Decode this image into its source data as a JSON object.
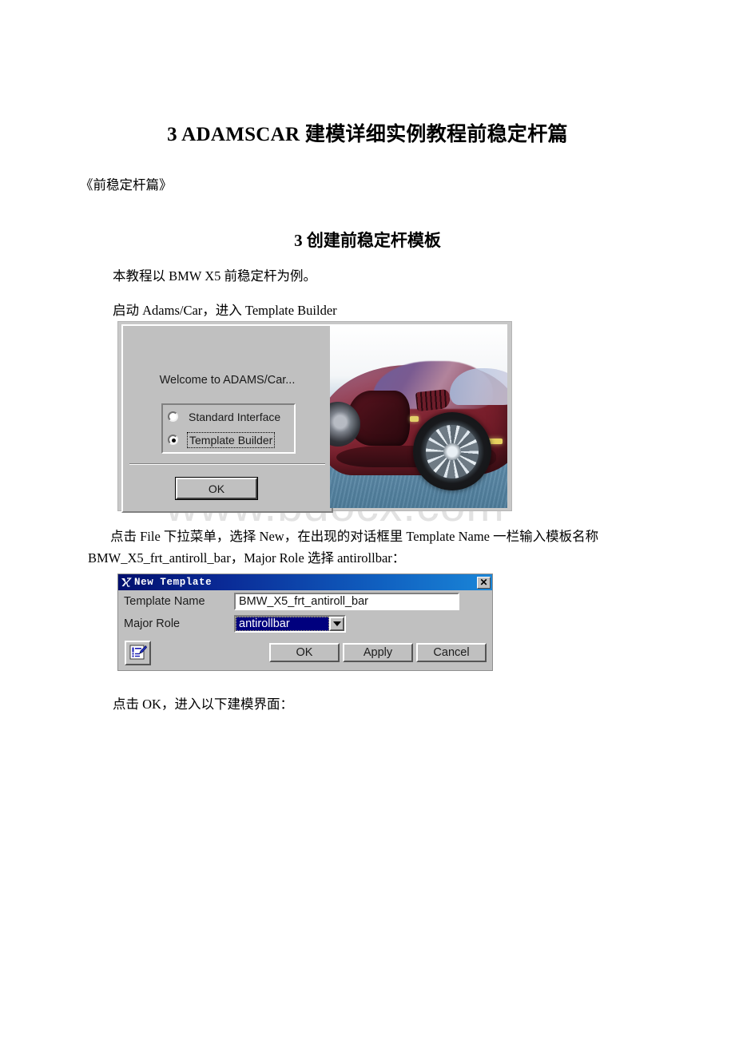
{
  "document": {
    "title": "3 ADAMSCAR 建模详细实例教程前稳定杆篇",
    "subtitle": "《前稳定杆篇》",
    "section_heading": "3 创建前稳定杆模板",
    "line_example": "本教程以 BMW X5 前稳定杆为例。",
    "line_launch": "启动 Adams/Car，进入 Template Builder",
    "paragraph_new_template": "点击 File 下拉菜单，选择 New，在出现的对话框里 Template Name 一栏输入模板名称 BMW_X5_frt_antiroll_bar，Major Role 选择 antirollbar：",
    "line_click_ok": "点击 OK，进入以下建模界面：",
    "watermark": "www.bdocx.com"
  },
  "welcome_dialog": {
    "prompt": "Welcome to ADAMS/Car...",
    "options": [
      {
        "label": "Standard Interface",
        "selected": false
      },
      {
        "label": "Template Builder",
        "selected": true
      }
    ],
    "ok_label": "OK",
    "car_image_alt": "red-sports-car-render"
  },
  "new_template_dialog": {
    "window_title": "New Template",
    "close_label": "✕",
    "fields": [
      {
        "label": "Template Name",
        "value": "BMW_X5_frt_antiroll_bar",
        "type": "text"
      },
      {
        "label": "Major Role",
        "value": "antirollbar",
        "type": "combo"
      }
    ],
    "buttons": [
      "OK",
      "Apply",
      "Cancel"
    ],
    "note_icon": "note-edit-icon"
  },
  "colors": {
    "titlebar_dark": "#000f6e",
    "titlebar_light": "#1a86d8",
    "dialog_face": "#c0c0c0",
    "selection_navy": "#00007e",
    "watermark_gray": "#e2e2e2"
  }
}
